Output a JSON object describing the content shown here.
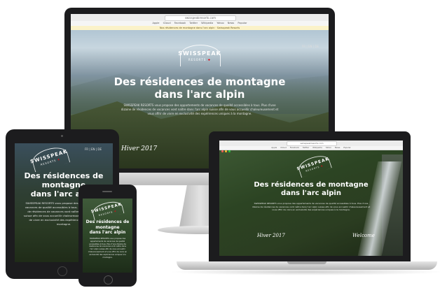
{
  "site": {
    "url": "swisspeakresorts.com",
    "brand_main": "SWISSPEAK",
    "brand_sub": "RESORTS",
    "hero_title": "Des résidences de montagne dans l'arc alpin",
    "hero_title_line1": "Des résidences de montagne",
    "hero_title_line2": "dans l'arc alpin",
    "hero_title_tablet_1": "Des résidences de",
    "hero_title_tablet_2": "montagne",
    "hero_title_tablet_3": "dans l'arc alpin",
    "hero_title_phone_1": "Des résidences de",
    "hero_title_phone_2": "montagne",
    "hero_title_phone_3": "dans l'arc alpin",
    "hero_body": "SWISSPEAK RESORTS vous propose des appartements de vacances de qualité accessibles à tous. Plus d'une dizaine de résidences de vacances vont naître dans l'arc alpin suisse afin de vous accueillir chaleureusement et vous offrir de vivre en exclusivité des expériences uniques à la montagne.",
    "signature": "Hiver 2017",
    "welcome_script": "Welcome",
    "lang_labels": [
      "FR",
      "EN",
      "DE"
    ],
    "nav_items": [
      "Apple",
      "iCloud",
      "Facebook",
      "Twitter",
      "Wikipedia",
      "Yahoo",
      "News",
      "Popular"
    ],
    "notice": "Nos résidences de montagne dans l'arc alpin · Swisspeak Resorts"
  },
  "colors": {
    "device_body": "#1c1c1e",
    "aluminium": "#c8c8c8",
    "accent_cross": "#e30613"
  },
  "icons": [
    "window-close-dot-icon",
    "window-minimize-dot-icon",
    "window-zoom-dot-icon",
    "home-button-icon",
    "camera-icon",
    "speaker-icon"
  ]
}
